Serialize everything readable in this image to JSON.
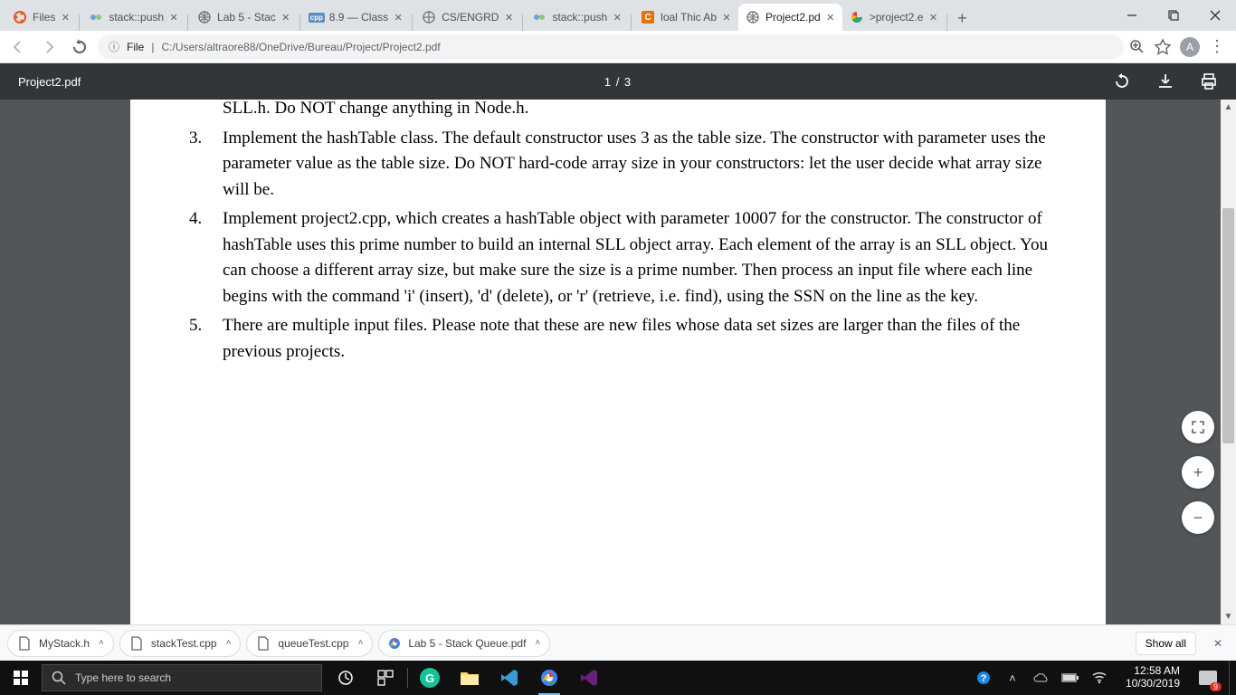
{
  "tabs": [
    {
      "title": "Files",
      "icon": "ubuntu"
    },
    {
      "title": "stack::push",
      "icon": "cpp-ref"
    },
    {
      "title": "Lab 5 - Stac",
      "icon": "globe"
    },
    {
      "title": "8.9 — Class",
      "icon": "cpp"
    },
    {
      "title": "CS/ENGRD",
      "icon": "globe"
    },
    {
      "title": "stack::push",
      "icon": "cpp-ref"
    },
    {
      "title": "loal Thic Ab",
      "icon": "chegg"
    },
    {
      "title": "Project2.pd",
      "icon": "globe",
      "active": true
    },
    {
      "title": ">project2.e",
      "icon": "google"
    }
  ],
  "address": {
    "prefix": "File",
    "path": "C:/Users/altraore88/OneDrive/Bureau/Project/Project2.pdf"
  },
  "avatar_letter": "A",
  "pdf": {
    "title": "Project2.pdf",
    "page": "1 / 3",
    "body": {
      "partial": "SLL.h. Do NOT change anything in Node.h.",
      "item2": "Implement the hashTable class. The default constructor uses 3 as the table size. The constructor with parameter uses the parameter value as the table size. Do NOT hard-code array size in your constructors: let the user decide what array size will be.",
      "item3": "Implement project2.cpp, which creates a hashTable object with parameter 10007 for the constructor. The constructor of hashTable uses this prime number to build an internal SLL object array. Each element of the array is an SLL object. You can choose a different array size, but make sure the size is a prime number. Then process an input file where each line begins with the command 'i' (insert), 'd' (delete), or 'r' (retrieve, i.e. find), using the SSN on the line as the key.",
      "item4": "There are multiple input files. Please note that these are new files whose data set sizes are larger than the files of the previous projects."
    }
  },
  "downloads": {
    "items": [
      "MyStack.h",
      "stackTest.cpp",
      "queueTest.cpp",
      "Lab 5 - Stack Queue.pdf"
    ],
    "show_all": "Show all"
  },
  "search_placeholder": "Type here to search",
  "clock": {
    "time": "12:58 AM",
    "date": "10/30/2019"
  },
  "notif_count": "9"
}
